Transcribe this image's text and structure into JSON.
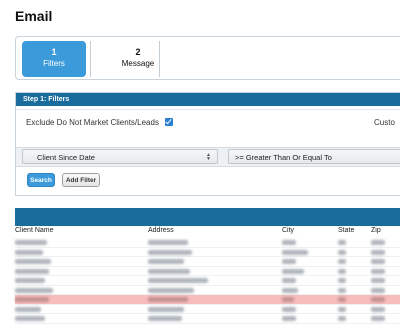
{
  "page": {
    "title": "Email"
  },
  "wizard": {
    "steps": [
      {
        "number": "1",
        "label": "Filters",
        "active": true
      },
      {
        "number": "2",
        "label": "Message",
        "active": false
      }
    ]
  },
  "filters_panel": {
    "header": "Step 1: Filters",
    "exclude_dnm_label": "Exclude Do Not Market Clients/Leads",
    "exclude_dnm_checked": true,
    "custom_label": "Custo",
    "field_select": "Client Since Date",
    "operator_select": ">= Greater Than Or Equal To",
    "search_button": "Search",
    "add_filter_button": "Add Filter"
  },
  "results_table": {
    "columns": [
      "Client Name",
      "Address",
      "City",
      "State",
      "Zip"
    ],
    "rows": [
      {
        "highlighted": false
      },
      {
        "highlighted": false
      },
      {
        "highlighted": false
      },
      {
        "highlighted": false
      },
      {
        "highlighted": false
      },
      {
        "highlighted": false
      },
      {
        "highlighted": true
      },
      {
        "highlighted": false
      },
      {
        "highlighted": false
      }
    ]
  },
  "colors": {
    "accent": "#3b9ad9",
    "header_band": "#1a6c9c",
    "highlight_row": "#f7bcbc"
  }
}
